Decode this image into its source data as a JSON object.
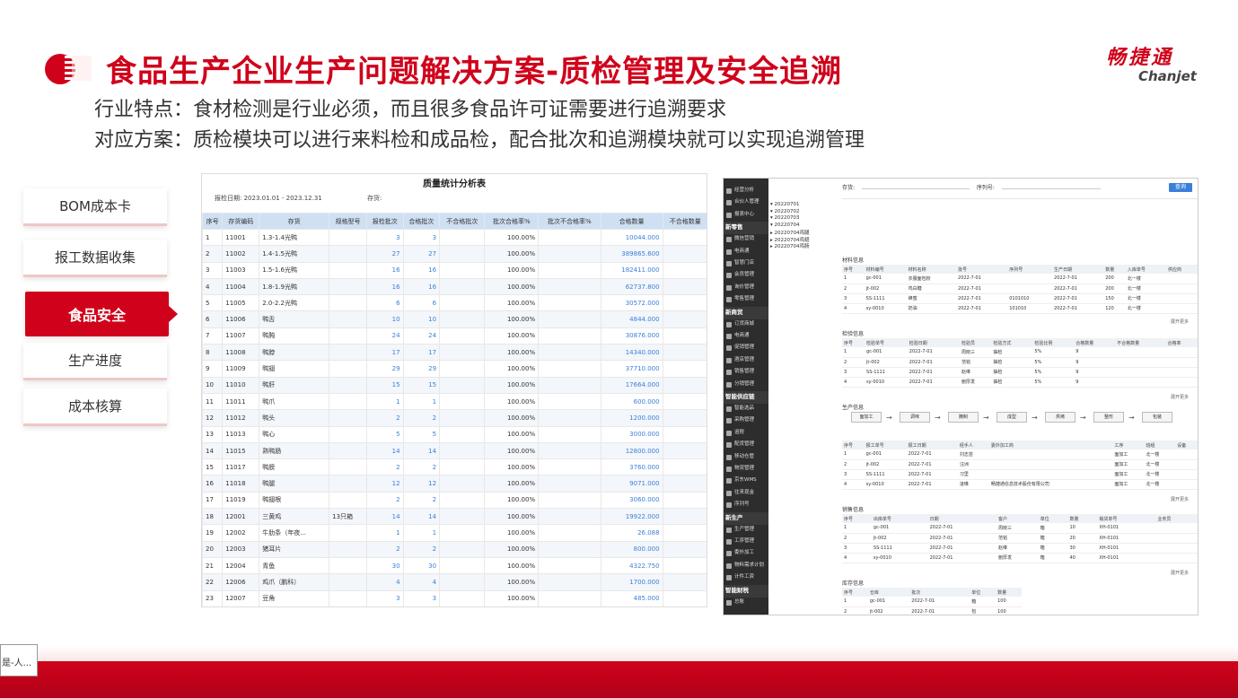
{
  "header": {
    "title": "食品生产企业生产问题解决方案-质检管理及安全追溯",
    "brand_cn": "畅捷通",
    "brand_en": "Chanjet",
    "line1": "行业特点：食材检测是行业必须，而且很多食品许可证需要进行追溯要求",
    "line2": "对应方案：质检模块可以进行来料检和成品检，配合批次和追溯模块就可以实现追溯管理"
  },
  "menu": {
    "items": [
      {
        "label": "BOM成本卡"
      },
      {
        "label": "报工数据收集"
      },
      {
        "label": "食品安全",
        "active": true
      },
      {
        "label": "生产进度"
      },
      {
        "label": "成本核算"
      }
    ]
  },
  "report": {
    "title": "质量统计分析表",
    "date_label": "报检日期:",
    "date_value": "2023.01.01 - 2023.12.31",
    "stock_label": "存货:",
    "columns": [
      "序号",
      "存货编码",
      "存货",
      "规格型号",
      "报检批次",
      "合格批次",
      "不合格批次",
      "批次合格率%",
      "批次不合格率%",
      "合格数量",
      "不合格数量"
    ],
    "rows": [
      [
        "1",
        "11001",
        "1.3-1.4光鸭",
        "",
        "3",
        "3",
        "",
        "100.00%",
        "",
        "10044.000",
        ""
      ],
      [
        "2",
        "11002",
        "1.4-1.5光鸭",
        "",
        "27",
        "27",
        "",
        "100.00%",
        "",
        "389865.600",
        ""
      ],
      [
        "3",
        "11003",
        "1.5-1.6光鸭",
        "",
        "16",
        "16",
        "",
        "100.00%",
        "",
        "182411.000",
        ""
      ],
      [
        "4",
        "11004",
        "1.8-1.9光鸭",
        "",
        "16",
        "16",
        "",
        "100.00%",
        "",
        "62737.800",
        ""
      ],
      [
        "5",
        "11005",
        "2.0-2.2光鸭",
        "",
        "6",
        "6",
        "",
        "100.00%",
        "",
        "30572.000",
        ""
      ],
      [
        "6",
        "11006",
        "鸭舌",
        "",
        "10",
        "10",
        "",
        "100.00%",
        "",
        "4844.000",
        ""
      ],
      [
        "7",
        "11007",
        "鸭肫",
        "",
        "24",
        "24",
        "",
        "100.00%",
        "",
        "30876.000",
        ""
      ],
      [
        "8",
        "11008",
        "鸭脖",
        "",
        "17",
        "17",
        "",
        "100.00%",
        "",
        "14340.000",
        ""
      ],
      [
        "9",
        "11009",
        "鸭翅",
        "",
        "29",
        "29",
        "",
        "100.00%",
        "",
        "37710.000",
        ""
      ],
      [
        "10",
        "11010",
        "鸭肝",
        "",
        "15",
        "15",
        "",
        "100.00%",
        "",
        "17664.000",
        ""
      ],
      [
        "11",
        "11011",
        "鸭爪",
        "",
        "1",
        "1",
        "",
        "100.00%",
        "",
        "600.000",
        ""
      ],
      [
        "12",
        "11012",
        "鸭头",
        "",
        "2",
        "2",
        "",
        "100.00%",
        "",
        "1200.000",
        ""
      ],
      [
        "13",
        "11013",
        "鸭心",
        "",
        "5",
        "5",
        "",
        "100.00%",
        "",
        "3000.000",
        ""
      ],
      [
        "14",
        "11015",
        "熟鸭肠",
        "",
        "14",
        "14",
        "",
        "100.00%",
        "",
        "12800.000",
        ""
      ],
      [
        "15",
        "11017",
        "鸭膀",
        "",
        "2",
        "2",
        "",
        "100.00%",
        "",
        "3760.000",
        ""
      ],
      [
        "16",
        "11018",
        "鸭腿",
        "",
        "12",
        "12",
        "",
        "100.00%",
        "",
        "9071.000",
        ""
      ],
      [
        "17",
        "11019",
        "鸭翅根",
        "",
        "2",
        "2",
        "",
        "100.00%",
        "",
        "3060.000",
        ""
      ],
      [
        "18",
        "12001",
        "三黄鸡",
        "13只箱",
        "14",
        "14",
        "",
        "100.00%",
        "",
        "19922.000",
        ""
      ],
      [
        "19",
        "12002",
        "牛肋条（年夜...",
        "",
        "1",
        "1",
        "",
        "100.00%",
        "",
        "26.088",
        ""
      ],
      [
        "20",
        "12003",
        "猪耳片",
        "",
        "2",
        "2",
        "",
        "100.00%",
        "",
        "800.000",
        ""
      ],
      [
        "21",
        "12004",
        "青鱼",
        "",
        "30",
        "30",
        "",
        "100.00%",
        "",
        "4322.750",
        ""
      ],
      [
        "22",
        "12006",
        "鸡爪（鹏科）",
        "",
        "4",
        "4",
        "",
        "100.00%",
        "",
        "1700.000",
        ""
      ],
      [
        "23",
        "12007",
        "豆角",
        "",
        "3",
        "3",
        "",
        "100.00%",
        "",
        "485.000",
        ""
      ]
    ]
  },
  "trace": {
    "search_label": "存货:",
    "batch_label": "序列号:",
    "query_button": "查询",
    "sidebar": [
      {
        "type": "it",
        "label": "经营分析"
      },
      {
        "type": "it",
        "label": "合伙人管理"
      },
      {
        "type": "it",
        "label": "报表中心"
      },
      {
        "type": "grp",
        "label": "新零售"
      },
      {
        "type": "it",
        "label": "微信营销"
      },
      {
        "type": "it",
        "label": "电商通"
      },
      {
        "type": "it",
        "label": "智慧门店"
      },
      {
        "type": "it",
        "label": "会员管理"
      },
      {
        "type": "it",
        "label": "询价管理"
      },
      {
        "type": "it",
        "label": "零售管理"
      },
      {
        "type": "grp",
        "label": "新商贸"
      },
      {
        "type": "it",
        "label": "订货商城"
      },
      {
        "type": "it",
        "label": "电商通"
      },
      {
        "type": "it",
        "label": "促销管理"
      },
      {
        "type": "it",
        "label": "酒店管理"
      },
      {
        "type": "it",
        "label": "销售管理"
      },
      {
        "type": "it",
        "label": "分销管理"
      },
      {
        "type": "grp",
        "label": "智能供应链"
      },
      {
        "type": "it",
        "label": "智能选品"
      },
      {
        "type": "it",
        "label": "采购管理"
      },
      {
        "type": "it",
        "label": "追税"
      },
      {
        "type": "it",
        "label": "配货管理"
      },
      {
        "type": "it",
        "label": "移动仓管"
      },
      {
        "type": "it",
        "label": "物流管理"
      },
      {
        "type": "it",
        "label": "京东WMS"
      },
      {
        "type": "it",
        "label": "往来现金"
      },
      {
        "type": "it",
        "label": "序列号"
      },
      {
        "type": "grp",
        "label": "新生产"
      },
      {
        "type": "it",
        "label": "生产管理"
      },
      {
        "type": "it",
        "label": "工序管理"
      },
      {
        "type": "it",
        "label": "委外加工"
      },
      {
        "type": "it",
        "label": "物料需求计划"
      },
      {
        "type": "it",
        "label": "计件工资"
      },
      {
        "type": "grp",
        "label": "智能财税"
      },
      {
        "type": "it",
        "label": "总账"
      }
    ],
    "tree": [
      "▾ 20220701",
      "▾ 20220702",
      "▾ 20220703",
      "▾ 20220704",
      "  ▸ 20220704鸡腿",
      "  ▸ 20220704鸡翅",
      "  ▸ 20220704鸡肠"
    ],
    "material_title": "材料信息",
    "material_cols": [
      "序号",
      "材料编号",
      "材料名称",
      "批号",
      "序列号",
      "生产日期",
      "数量",
      "入库单号",
      "供应商"
    ],
    "material_rows": [
      [
        "1",
        "gc-001",
        "衣服面包粉",
        "2022-7-01",
        "",
        "2022-7-01",
        "200",
        "北一楼",
        ""
      ],
      [
        "2",
        "jt-002",
        "鸡白糖",
        "2022-7-01",
        "",
        "2022-7-01",
        "200",
        "北一楼",
        ""
      ],
      [
        "3",
        "SS-1111",
        "蜂蜜",
        "2022-7-01",
        "0101010",
        "2022-7-01",
        "150",
        "北一楼",
        ""
      ],
      [
        "4",
        "sy-0010",
        "奶油",
        "2022-7-01",
        "101010",
        "2022-7-01",
        "120",
        "北一楼",
        ""
      ]
    ],
    "inspect_title": "检验信息",
    "inspect_cols": [
      "序号",
      "检验单号",
      "检验日期",
      "检验员",
      "检验方式",
      "检验比例",
      "合格数量",
      "不合格数量",
      "合格率"
    ],
    "inspect_rows": [
      [
        "1",
        "gc-001",
        "2022-7-01",
        "周晓三",
        "抽检",
        "5%",
        "9",
        "",
        ""
      ],
      [
        "2",
        "jt-002",
        "2022-7-01",
        "范铭",
        "抽检",
        "5%",
        "9",
        "",
        ""
      ],
      [
        "3",
        "SS-1111",
        "2022-7-01",
        "赵维",
        "抽检",
        "5%",
        "9",
        "",
        ""
      ],
      [
        "4",
        "sy-0010",
        "2022-7-01",
        "鲍厚发",
        "抽检",
        "5%",
        "9",
        "",
        ""
      ]
    ],
    "prod_title": "生产信息",
    "flow": [
      "面加工",
      "调味",
      "腌制",
      "成型",
      "烘烤",
      "整形",
      "包装"
    ],
    "prod_cols": [
      "序号",
      "报工单号",
      "报工日期",
      "经手人",
      "委外加工商",
      "工序",
      "班组",
      "设备"
    ],
    "prod_rows": [
      [
        "1",
        "gc-001",
        "2022-7-01",
        "刘志芸",
        "",
        "面加工",
        "北一楼",
        ""
      ],
      [
        "2",
        "jt-002",
        "2022-7-01",
        "汪洲",
        "",
        "面加工",
        "北一楼",
        ""
      ],
      [
        "3",
        "SS-1111",
        "2022-7-01",
        "习里",
        "",
        "面加工",
        "北一楼",
        ""
      ],
      [
        "4",
        "sy-0010",
        "2022-7-01",
        "凌琳",
        "畅捷通信息技术股份有限公司",
        "面加工",
        "北一楼",
        ""
      ]
    ],
    "sales_title": "销售信息",
    "sales_cols": [
      "序号",
      "出库单号",
      "日期",
      "客户",
      "单位",
      "数量",
      "销货单号",
      "业务员"
    ],
    "sales_rows": [
      [
        "1",
        "gc-001",
        "2022-7-01",
        "周晓三",
        "箱",
        "10",
        "XH-0101",
        ""
      ],
      [
        "2",
        "jt-002",
        "2022-7-01",
        "范铭",
        "箱",
        "20",
        "XH-0101",
        ""
      ],
      [
        "3",
        "SS-1111",
        "2022-7-01",
        "赵维",
        "箱",
        "30",
        "XH-0101",
        ""
      ],
      [
        "4",
        "sy-0010",
        "2022-7-01",
        "鲍厚发",
        "箱",
        "40",
        "XH-0101",
        ""
      ]
    ],
    "stock_title": "库存信息",
    "stock_cols": [
      "序号",
      "仓库",
      "批次",
      "单位",
      "数量"
    ],
    "stock_rows": [
      [
        "1",
        "gc-001",
        "2022-7-01",
        "箱",
        "100"
      ],
      [
        "2",
        "jt-002",
        "2022-7-01",
        "包",
        "100"
      ]
    ],
    "more_label": "展开更多"
  },
  "tooltip": "是-人..."
}
